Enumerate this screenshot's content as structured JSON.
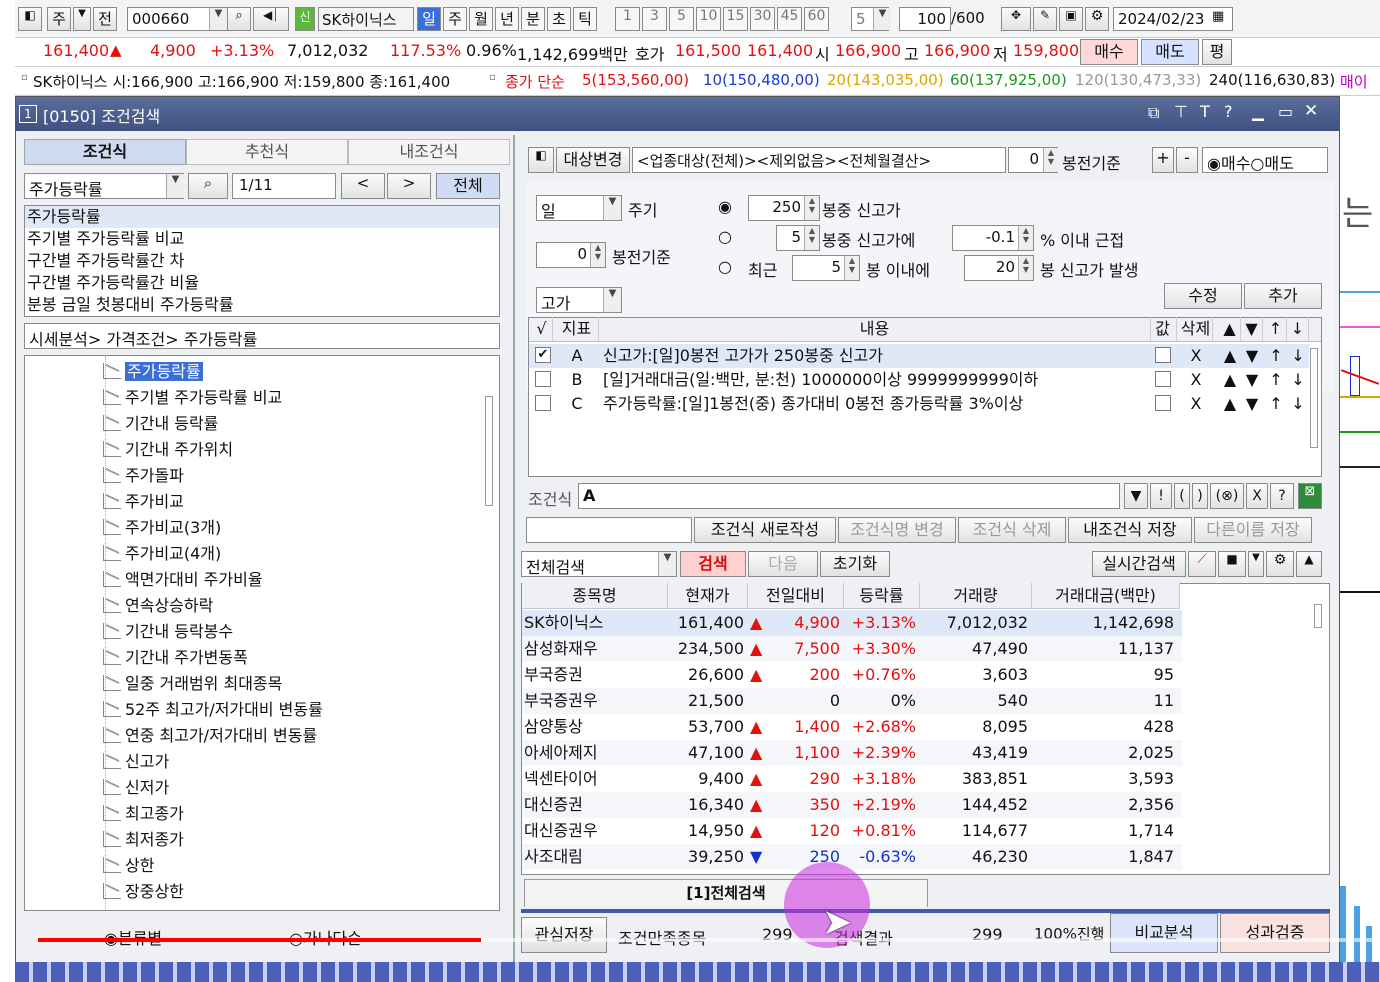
{
  "toolbar1": {
    "stock_code": "000660",
    "stock_name": "SK하이닉스",
    "tabs": [
      "주",
      "전"
    ],
    "periods": [
      "일",
      "주",
      "월",
      "년",
      "분",
      "초",
      "틱"
    ],
    "minutes": [
      "1",
      "3",
      "5",
      "10",
      "15",
      "30",
      "45",
      "60"
    ],
    "count_sel": "5",
    "range": "100",
    "range_max": "/600",
    "date": "2024/02/23"
  },
  "quote": {
    "price": "161,400",
    "change": "4,900",
    "rate": "+3.13%",
    "volume": "7,012,032",
    "ratio": "117.53%",
    "turnover": "0.96%",
    "amount": "1,142,699백만",
    "ask_label": "호가",
    "ask": "161,500",
    "bid": "161,400",
    "open_label": "시",
    "open": "166,900",
    "high_label": "고",
    "high": "166,900",
    "low_label": "저",
    "low": "159,800",
    "buy": "매수",
    "sell": "매도",
    "avg": "평"
  },
  "ticker": {
    "summary": "SK하이닉스 시:166,900 고:166,900 저:159,800 종:161,400",
    "ma_label": "종가 단순",
    "ma5": "5(153,560,00)",
    "ma10": "10(150,480,00)",
    "ma20": "20(143,035,00)",
    "ma60": "60(137,925,00)",
    "ma120": "120(130,473,33)",
    "ma240": "240(116,630,83)",
    "more": "매이"
  },
  "window": {
    "num": "1",
    "title": "[0150] 조건검색"
  },
  "left": {
    "tabs": [
      "조건식",
      "추천식",
      "내조건식"
    ],
    "search_value": "주가등락률",
    "page": "1/11",
    "all_btn": "전체",
    "results": [
      "주가등락률",
      "주기별 주가등락률 비교",
      "구간별 주가등락률간 차",
      "구간별 주가등락률간 비율",
      "분봉 금일 첫봉대비 주가등락률"
    ],
    "path": "시세분석> 가격조건> 주가등락률",
    "tree": [
      "주가등락률",
      "주기별 주가등락률 비교",
      "기간내 등락률",
      "기간내 주가위치",
      "주가돌파",
      "주가비교",
      "주가비교(3개)",
      "주가비교(4개)",
      "액면가대비 주가비율",
      "연속상승하락",
      "기간내 등락봉수",
      "기간내 주가변동폭",
      "일중 거래범위 최대종목",
      "52주 최고가/저가대비 변동률",
      "연중 최고가/저가대비 변동률",
      "신고가",
      "신저가",
      "최고종가",
      "최저종가",
      "상한",
      "장중상한"
    ],
    "radio1": "분류별",
    "radio2": "가나다순"
  },
  "right": {
    "target_btn": "대상변경",
    "target_text": "<업종대상(전체)><제외없음><전체월결산>",
    "bong_val": "0",
    "bong_label": "봉전기준",
    "plus": "+",
    "minus": "-",
    "buy": "매수",
    "sell": "매도",
    "period_val": "일",
    "period_label": "주기",
    "bong2_val": "0",
    "bong2_label": "봉전기준",
    "price_type": "고가",
    "opt1_val": "250",
    "opt1_label": "봉중 신고가",
    "opt2_val": "5",
    "opt2_label": "봉중 신고가에",
    "opt2_pct": "-0.1",
    "opt2_tail": "% 이내 근접",
    "opt3_pre": "최근",
    "opt3_val": "5",
    "opt3_mid": "봉 이내에",
    "opt3_val2": "20",
    "opt3_tail": "봉 신고가 발생",
    "edit_btn": "수정",
    "add_btn": "추가",
    "cond_headers": [
      "√",
      "지표",
      "내용",
      "값",
      "삭제",
      "▲",
      "▼",
      "↑",
      "↓"
    ],
    "conditions": [
      {
        "id": "A",
        "text": "신고가:[일]0봉전 고가가 250봉중 신고가",
        "checked": true
      },
      {
        "id": "B",
        "text": "[일]거래대금(일:백만, 분:천) 1000000이상 9999999999이하",
        "checked": false
      },
      {
        "id": "C",
        "text": "주가등락률:[일]1봉전(중) 종가대비 0봉전 종가등락률 3%이상",
        "checked": false
      }
    ],
    "formula_label": "조건식",
    "formula": "A",
    "formula_btns": [
      "▼",
      "!",
      "(",
      ")",
      "(⊗)",
      "X",
      "?"
    ],
    "action_btns": [
      "조건식 새로작성",
      "조건식명 변경",
      "조건식 삭제",
      "내조건식 저장",
      "다른이름 저장"
    ],
    "search_scope": "전체검색",
    "search_btn": "검색",
    "next_btn": "다음",
    "reset_btn": "초기화",
    "realtime_btn": "실시간검색",
    "grid_headers": [
      "종목명",
      "현재가",
      "전일대비",
      "등락률",
      "거래량",
      "거래대금(백만)"
    ],
    "rows": [
      {
        "name": "SK하이닉스",
        "price": "161,400",
        "dir": "up",
        "chg": "4,900",
        "rate": "+3.13%",
        "vol": "7,012,032",
        "amt": "1,142,698"
      },
      {
        "name": "삼성화재우",
        "price": "234,500",
        "dir": "up",
        "chg": "7,500",
        "rate": "+3.30%",
        "vol": "47,490",
        "amt": "11,137"
      },
      {
        "name": "부국증권",
        "price": "26,600",
        "dir": "up",
        "chg": "200",
        "rate": "+0.76%",
        "vol": "3,603",
        "amt": "95"
      },
      {
        "name": "부국증권우",
        "price": "21,500",
        "dir": "",
        "chg": "0",
        "rate": "0%",
        "vol": "540",
        "amt": "11"
      },
      {
        "name": "삼양통상",
        "price": "53,700",
        "dir": "up",
        "chg": "1,400",
        "rate": "+2.68%",
        "vol": "8,095",
        "amt": "428"
      },
      {
        "name": "아세아제지",
        "price": "47,100",
        "dir": "up",
        "chg": "1,100",
        "rate": "+2.39%",
        "vol": "43,419",
        "amt": "2,025"
      },
      {
        "name": "넥센타이어",
        "price": "9,400",
        "dir": "up",
        "chg": "290",
        "rate": "+3.18%",
        "vol": "383,851",
        "amt": "3,593"
      },
      {
        "name": "대신증권",
        "price": "16,340",
        "dir": "up",
        "chg": "350",
        "rate": "+2.19%",
        "vol": "144,452",
        "amt": "2,356"
      },
      {
        "name": "대신증권우",
        "price": "14,950",
        "dir": "up",
        "chg": "120",
        "rate": "+0.81%",
        "vol": "114,677",
        "amt": "1,714"
      },
      {
        "name": "사조대림",
        "price": "39,250",
        "dir": "down",
        "chg": "250",
        "rate": "-0.63%",
        "vol": "46,230",
        "amt": "1,847"
      }
    ],
    "result_tab": "[1]전체검색",
    "bottom": {
      "fav_btn": "관심저장",
      "match_label": "조건만족종목",
      "match_val": "299",
      "result_label": "검색결과",
      "result_val": "299",
      "progress": "100%진행",
      "compare_btn": "비교분석",
      "perf_btn": "성과검증"
    }
  },
  "video": {
    "progress": 0.33
  },
  "colors": {
    "up": "#e31010",
    "down": "#1430d0",
    "title_bar": "#4a5d8a",
    "accent": "#2b5fd0"
  }
}
